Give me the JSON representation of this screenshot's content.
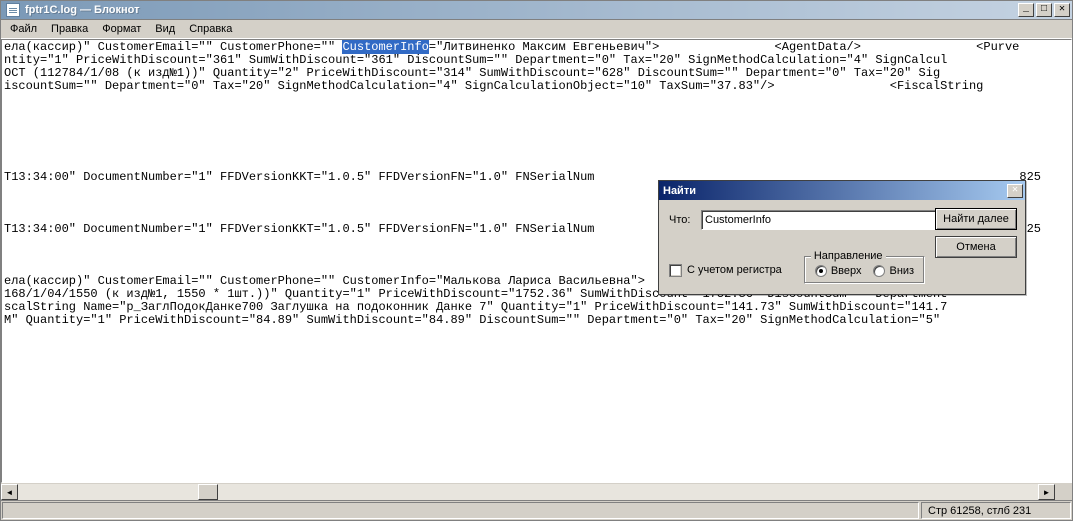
{
  "window": {
    "title": "fptr1C.log — Блокнот"
  },
  "menu": {
    "file": "Файл",
    "edit": "Правка",
    "format": "Формат",
    "view": "Вид",
    "help": "Справка"
  },
  "content": {
    "line1a": "ела(кассир)\" CustomerEmail=\"\" CustomerPhone=\"\" ",
    "line1_highlight": "CustomerInfo",
    "line1b": "=\"Литвиненко Максим Евгеньевич\">                <AgentData/>                <Purve",
    "line2": "ntity=\"1\" PriceWithDiscount=\"361\" SumWithDiscount=\"361\" DiscountSum=\"\" Department=\"0\" Tax=\"20\" SignMethodCalculation=\"4\" SignCalcul",
    "line3": "ОСТ (112784/1/08 (к изд№1))\" Quantity=\"2\" PriceWithDiscount=\"314\" SumWithDiscount=\"628\" DiscountSum=\"\" Department=\"0\" Tax=\"20\" Sig",
    "line4": "iscountSum=\"\" Department=\"0\" Tax=\"20\" SignMethodCalculation=\"4\" SignCalculationObject=\"10\" TaxSum=\"37.83\"/>                <FiscalString ",
    "line5": "",
    "blank": "",
    "line6": "T13:34:00\" DocumentNumber=\"1\" FFDVersionKKT=\"1.0.5\" FFDVersionFN=\"1.0\" FNSerialNum                                                           825",
    "line7": "",
    "line8": "T13:34:00\" DocumentNumber=\"1\" FFDVersionKKT=\"1.0.5\" FFDVersionFN=\"1.0\" FNSerialNum                                                           825",
    "line9": "",
    "line10": "ела(кассир)\" CustomerEmail=\"\" CustomerPhone=\"\" CustomerInfo=\"Малькова Лариса Васильевна\">                <AgentData/>                <Purve",
    "line11": "168/1/04/1550 (к изд№1, 1550 * 1шт.))\" Quantity=\"1\" PriceWithDiscount=\"1752.36\" SumWithDiscount=\"1752.36\" DiscountSum=\"\" Department",
    "line12": "scalString Name=\"р_ЗаглПодокДанке700 Заглушка на подоконник Данке 7\" Quantity=\"1\" PriceWithDiscount=\"141.73\" SumWithDiscount=\"141.7",
    "line13": "M\" Quantity=\"1\" PriceWithDiscount=\"84.89\" SumWithDiscount=\"84.89\" DiscountSum=\"\" Department=\"0\" Tax=\"20\" SignMethodCalculation=\"5\" "
  },
  "find": {
    "title": "Найти",
    "what_label": "Что:",
    "what_value": "CustomerInfo",
    "find_next": "Найти далее",
    "cancel": "Отмена",
    "match_case": "С учетом регистра",
    "direction": "Направление",
    "up": "Вверх",
    "down": "Вниз",
    "selected": "up"
  },
  "status": {
    "position": "Стр 61258, стлб 231"
  },
  "winbtns": {
    "min": "_",
    "max": "□",
    "close": "✕"
  },
  "dlg_close": "✕",
  "arrows": {
    "left": "◄",
    "right": "►"
  }
}
